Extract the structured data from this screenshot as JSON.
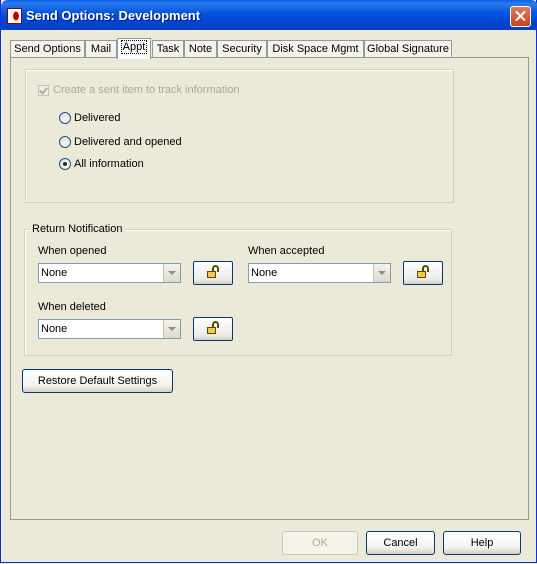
{
  "window": {
    "title": "Send Options:  Development"
  },
  "tabs": [
    {
      "label": "Send Options"
    },
    {
      "label": "Mail"
    },
    {
      "label": "Appt"
    },
    {
      "label": "Task"
    },
    {
      "label": "Note"
    },
    {
      "label": "Security"
    },
    {
      "label": "Disk Space Mgmt"
    },
    {
      "label": "Global Signature"
    }
  ],
  "active_tab": "Appt",
  "tracking": {
    "checkbox_label": "Create a sent item to track information",
    "checked": true,
    "enabled": false,
    "options": [
      {
        "label": "Delivered",
        "selected": false
      },
      {
        "label": "Delivered and opened",
        "selected": false
      },
      {
        "label": "All information",
        "selected": true
      }
    ]
  },
  "return_notification": {
    "legend": "Return Notification",
    "when_opened": {
      "label": "When opened",
      "value": "None"
    },
    "when_accepted": {
      "label": "When accepted",
      "value": "None"
    },
    "when_deleted": {
      "label": "When deleted",
      "value": "None"
    }
  },
  "restore_button": "Restore Default Settings",
  "footer": {
    "ok": "OK",
    "cancel": "Cancel",
    "help": "Help",
    "ok_enabled": false
  },
  "icons": {
    "app": "novell-app-icon",
    "close": "close-icon",
    "lock": "unlocked-padlock-icon"
  },
  "colors": {
    "titlebar": "#0A5FE8",
    "dialog_bg": "#ECE9D8",
    "close_button": "#C74426"
  }
}
